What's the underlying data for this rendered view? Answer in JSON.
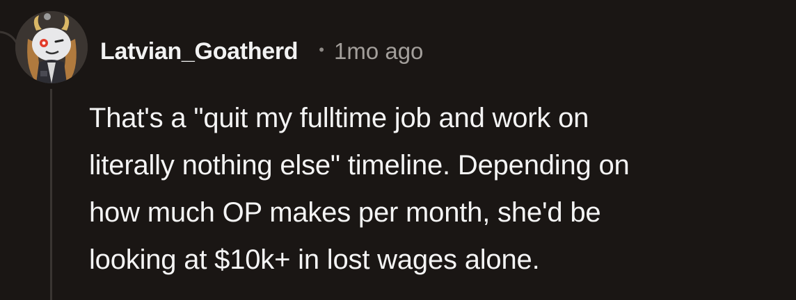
{
  "comment": {
    "author": "Latvian_Goatherd",
    "separator": "•",
    "timestamp": "1mo ago",
    "avatar_icon": "snoo-goat-avatar-icon",
    "lines": [
      "That's a \"quit my fulltime job and work on",
      "literally nothing else\" timeline. Depending on",
      "how much OP makes per month, she'd be",
      "looking at $10k+ in lost wages alone."
    ]
  },
  "colors": {
    "background": "#1a1614",
    "text": "#f4f4f4",
    "meta": "#a39f9b",
    "thread_line": "#3a3532"
  }
}
